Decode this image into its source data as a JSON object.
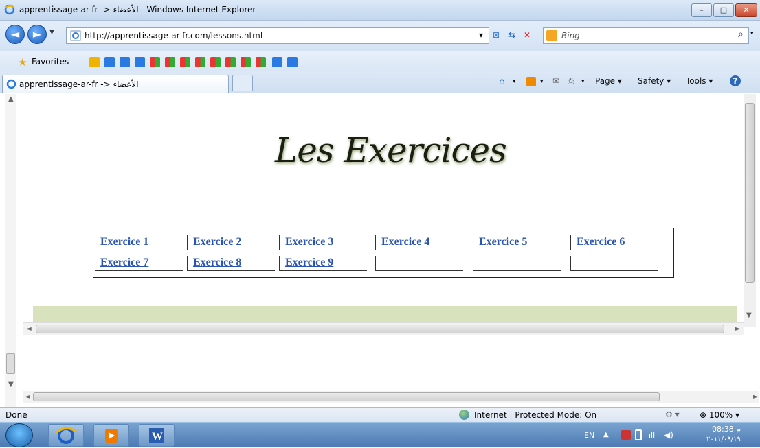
{
  "window": {
    "title": "apprentissage-ar-fr -> الأعضاء - Windows Internet Explorer",
    "controls": {
      "minimize": "–",
      "maximize": "□",
      "close": "✕"
    }
  },
  "navbar": {
    "back": "◄",
    "forward": "►",
    "dropdown": "▼",
    "url_prefix": "http://",
    "url_domain": "apprentissage-ar-fr.com",
    "url_path": "/lessons.html",
    "search_placeholder": "Bing",
    "search_icon": "⌕"
  },
  "favorites": {
    "label": "Favorites"
  },
  "tab": {
    "label": "apprentissage-ar-fr -> الأعضاء"
  },
  "command_bar": {
    "page": "Page ▾",
    "safety": "Safety ▾",
    "tools": "Tools ▾",
    "help": "?"
  },
  "page": {
    "logo_text": "Les Exercices",
    "exercises": [
      {
        "label": "Exercice 1"
      },
      {
        "label": "Exercice 2"
      },
      {
        "label": "Exercice 3"
      },
      {
        "label": "Exercice 4"
      },
      {
        "label": "Exercice 5"
      },
      {
        "label": "Exercice 6"
      },
      {
        "label": "Exercice 7"
      },
      {
        "label": "Exercice 8"
      },
      {
        "label": "Exercice 9"
      }
    ]
  },
  "statusbar": {
    "left": "Done",
    "zone": "Internet | Protected Mode: On",
    "zoom": "100%"
  },
  "taskbar": {
    "lang": "EN",
    "time": "08:38 م",
    "date": "٢٠١١/٠٩/١٩"
  },
  "colors": {
    "link": "#2b55b0",
    "greenbar": "#d8e2bc",
    "chrome": "#d3e2f5"
  }
}
